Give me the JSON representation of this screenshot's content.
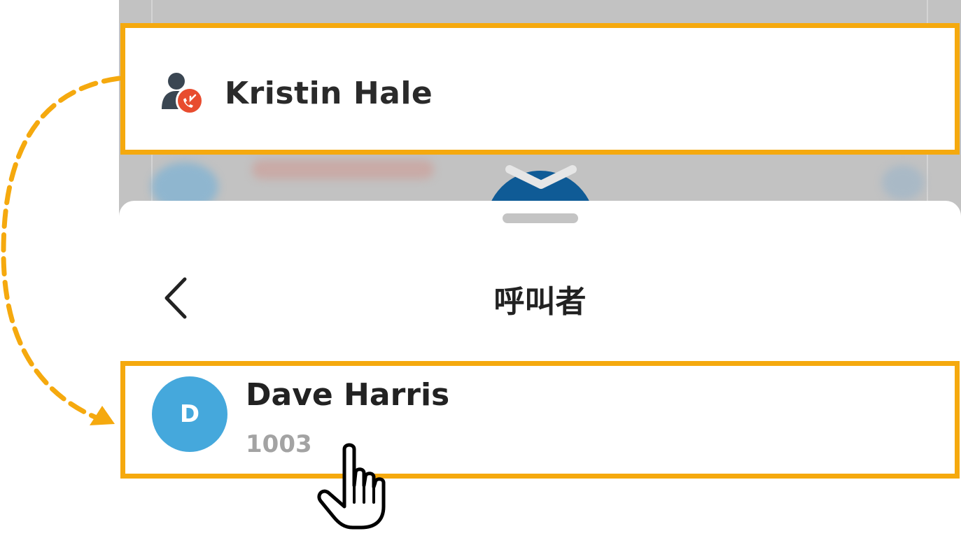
{
  "colors": {
    "highlight": "#f5a90e",
    "avatar": "#45a8dc",
    "missed_call_badge": "#e84c2f",
    "text_primary": "#222222",
    "text_secondary": "#a3a3a3"
  },
  "caller_card": {
    "icon": "missed-call-contact-icon",
    "name": "Kristin Hale"
  },
  "sheet": {
    "back_icon": "chevron-left-icon",
    "title": "呼叫者",
    "contact": {
      "avatar_initial": "D",
      "name": "Dave Harris",
      "extension": "1003"
    }
  },
  "annotations": {
    "arrow": "dashed-curved-arrow",
    "pointer": "hand-pointer-icon"
  }
}
